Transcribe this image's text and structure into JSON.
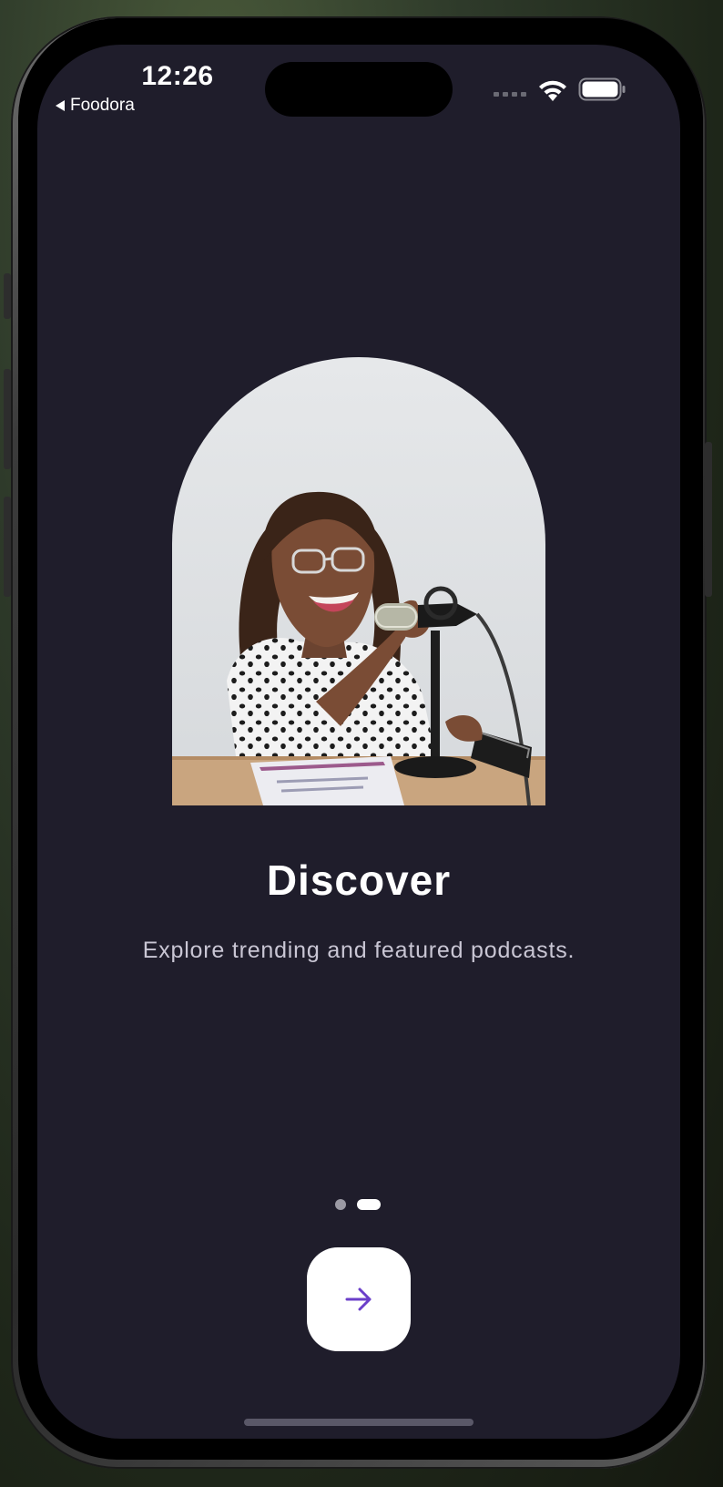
{
  "status_bar": {
    "time": "12:26",
    "back_app": "Foodora"
  },
  "onboarding": {
    "title": "Discover",
    "subtitle": "Explore trending and featured podcasts.",
    "page_count": 2,
    "current_page": 2,
    "next_button_icon": "arrow-right-icon"
  },
  "colors": {
    "screen_background": "#1f1d2b",
    "accent": "#6b3fc9",
    "button_background": "#ffffff"
  }
}
